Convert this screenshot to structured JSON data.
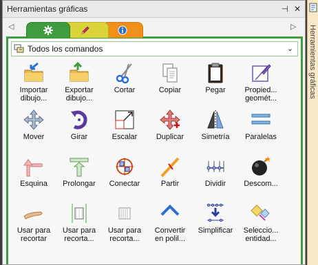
{
  "panel": {
    "title": "Herramientas gráficas",
    "pin_glyph": "⊣",
    "close_glyph": "✕"
  },
  "tabstrip": {
    "left_arrow": "◁",
    "right_arrow": "▷",
    "tabs": [
      {
        "icon": "gear-icon",
        "color": "#3f9d3f",
        "active": true
      },
      {
        "icon": "pencil-icon",
        "color": "#dcd23a",
        "active": false
      },
      {
        "icon": "info-icon",
        "color": "#f08f1a",
        "active": false
      }
    ]
  },
  "dropdown": {
    "selected": "Todos los comandos",
    "chevron": "⌄"
  },
  "commands": [
    {
      "label": "Importar\ndibujo...",
      "icon": "import-drawing-icon"
    },
    {
      "label": "Exportar\ndibujo...",
      "icon": "export-drawing-icon"
    },
    {
      "label": "Cortar",
      "icon": "scissors-icon"
    },
    {
      "label": "Copiar",
      "icon": "copy-icon"
    },
    {
      "label": "Pegar",
      "icon": "paste-icon"
    },
    {
      "label": "Propied...\ngeomét...",
      "icon": "geometry-properties-icon"
    },
    {
      "label": "Mover",
      "icon": "move-icon"
    },
    {
      "label": "Girar",
      "icon": "rotate-icon"
    },
    {
      "label": "Escalar",
      "icon": "scale-icon"
    },
    {
      "label": "Duplicar",
      "icon": "duplicate-icon"
    },
    {
      "label": "Simetría",
      "icon": "symmetry-icon"
    },
    {
      "label": "Paralelas",
      "icon": "parallel-icon"
    },
    {
      "label": "Esquina",
      "icon": "corner-icon"
    },
    {
      "label": "Prolongar",
      "icon": "extend-icon"
    },
    {
      "label": "Conectar",
      "icon": "connect-icon"
    },
    {
      "label": "Partir",
      "icon": "split-icon"
    },
    {
      "label": "Dividir",
      "icon": "divide-icon"
    },
    {
      "label": "Descom...",
      "icon": "explode-icon"
    },
    {
      "label": "Usar para\nrecortar",
      "icon": "use-to-trim-icon"
    },
    {
      "label": "Usar para\nrecorta...",
      "icon": "use-to-trim-2-icon"
    },
    {
      "label": "Usar para\nrecorta...",
      "icon": "use-to-trim-3-icon"
    },
    {
      "label": "Convertir\nen polil...",
      "icon": "convert-polyline-icon"
    },
    {
      "label": "Simplificar",
      "icon": "simplify-icon"
    },
    {
      "label": "Seleccio...\nentidad...",
      "icon": "select-entity-icon"
    }
  ],
  "sidebar": {
    "label": "Herramientas gráficas"
  }
}
